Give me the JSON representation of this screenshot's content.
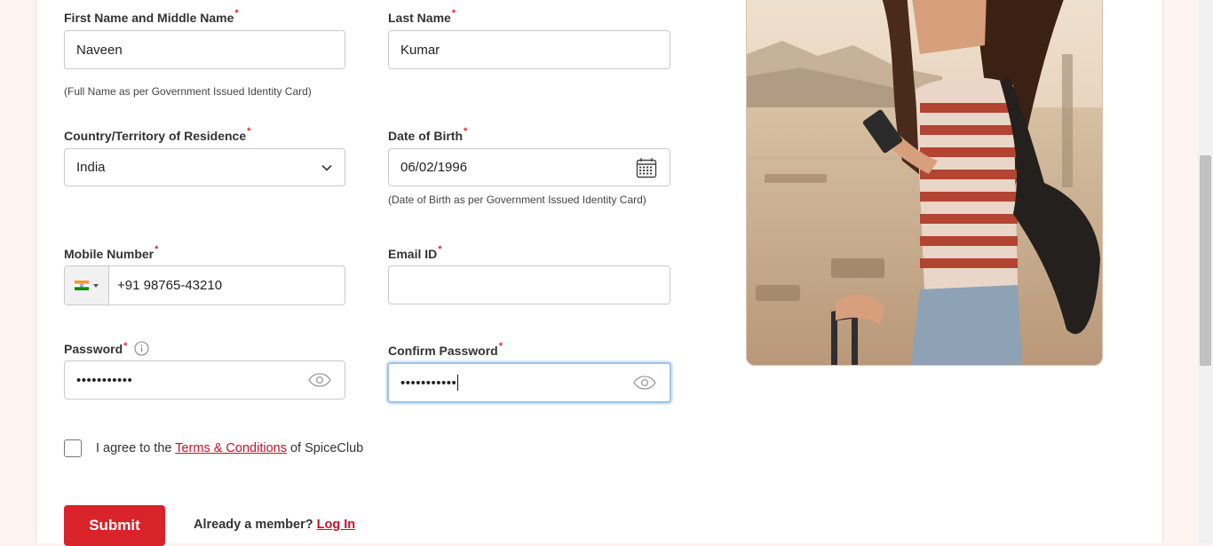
{
  "form": {
    "first_name": {
      "label": "First Name and Middle Name",
      "required": "*",
      "value": "Naveen",
      "hint": "(Full Name as per Government Issued Identity Card)"
    },
    "last_name": {
      "label": "Last Name",
      "required": "*",
      "value": "Kumar"
    },
    "country": {
      "label": "Country/Territory of Residence",
      "required": "*",
      "value": "India"
    },
    "dob": {
      "label": "Date of Birth",
      "required": "*",
      "value": "06/02/1996",
      "hint": "(Date of Birth as per Government Issued Identity Card)"
    },
    "mobile": {
      "label": "Mobile Number",
      "required": "*",
      "value": "+91 98765-43210"
    },
    "email": {
      "label": "Email ID",
      "required": "*",
      "value": ""
    },
    "password": {
      "label": "Password",
      "required": "*",
      "value": "•••••••••••"
    },
    "confirm_password": {
      "label": "Confirm Password",
      "required": "*",
      "value": "•••••••••••"
    },
    "terms": {
      "prefix": "I agree to the",
      "link": "Terms & Conditions",
      "suffix": "of SpiceClub"
    },
    "submit_label": "Submit",
    "member_text": "Already a member?",
    "login_link": "Log In"
  },
  "colors": {
    "accent": "#d8232a",
    "required": "#e0262b",
    "focus": "#9fc2e8"
  },
  "icons": {
    "dropdown": "chevron-down-icon",
    "calendar": "calendar-icon",
    "eye": "eye-icon",
    "info": "info-icon",
    "flag": "india-flag-icon"
  }
}
